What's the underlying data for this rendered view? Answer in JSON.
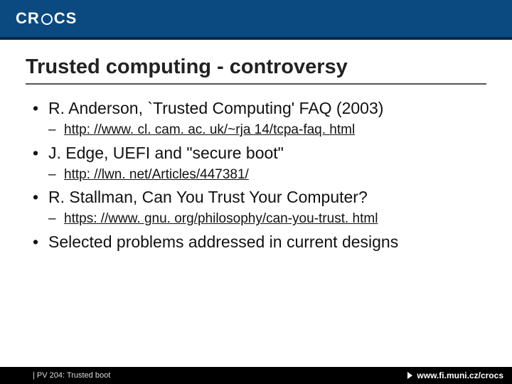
{
  "header": {
    "logo_text_left": "CR",
    "logo_text_right": "CS"
  },
  "slide": {
    "title": "Trusted computing - controversy",
    "items": [
      {
        "text": "R. Anderson, `Trusted Computing' FAQ (2003)",
        "sub": "http: //www. cl. cam. ac. uk/~rja 14/tcpa-faq. html"
      },
      {
        "text": "J. Edge, UEFI and \"secure boot\"",
        "sub": "http: //lwn. net/Articles/447381/"
      },
      {
        "text": "R. Stallman, Can You Trust Your Computer?",
        "sub": "https: //www. gnu. org/philosophy/can-you-trust. html"
      },
      {
        "text": "Selected problems addressed in current designs",
        "sub": null
      }
    ]
  },
  "footer": {
    "left": "| PV 204: Trusted boot",
    "right": "www.fi.muni.cz/crocs"
  }
}
